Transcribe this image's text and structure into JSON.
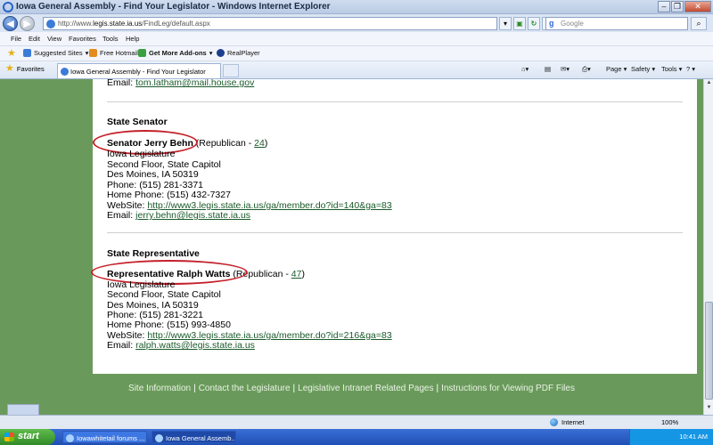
{
  "window": {
    "title": "Iowa General Assembly - Find Your Legislator - Windows Internet Explorer"
  },
  "address": {
    "prefix": "http://www.",
    "host": "legis.state.ia.us",
    "path": "/FindLeg/default.aspx"
  },
  "search": {
    "placeholder": "Google"
  },
  "menu": [
    "File",
    "Edit",
    "View",
    "Favorites",
    "Tools",
    "Help"
  ],
  "links": {
    "suggested": "Suggested Sites",
    "hotmail": "Free Hotmail",
    "addons": "Get More Add-ons",
    "realplayer": "RealPlayer"
  },
  "tabs": {
    "favorites": "Favorites",
    "active_tab": "Iowa General Assembly - Find Your Legislator"
  },
  "commands": {
    "page": "Page",
    "safety": "Safety",
    "tools": "Tools",
    "help": "?"
  },
  "content": {
    "prev_email_label": "Email:",
    "prev_email": "tom.latham@mail.house.gov",
    "senator": {
      "section": "State Senator",
      "name": "Senator Jerry Behn",
      "party_prefix": "(Republican - ",
      "district": "24",
      "party_suffix": ")",
      "org": "Iowa Legislature",
      "address1": "Second Floor, State Capitol",
      "address2": "Des Moines, IA   50319",
      "phone": "Phone: (515) 281-3371",
      "home_phone": "Home Phone: (515) 432-7327",
      "website_label": "WebSite:",
      "website": "http://www3.legis.state.ia.us/ga/member.do?id=140&ga=83",
      "email_label": "Email:",
      "email": "jerry.behn@legis.state.ia.us"
    },
    "representative": {
      "section": "State Representative",
      "name": "Representative Ralph Watts",
      "party_prefix": "(Republican - ",
      "district": "47",
      "party_suffix": ")",
      "org": "Iowa Legislature",
      "address1": "Second Floor, State Capitol",
      "address2": "Des Moines, IA   50319",
      "phone": "Phone: (515) 281-3221",
      "home_phone": "Home Phone: (515) 993-4850",
      "website_label": "WebSite:",
      "website": "http://www3.legis.state.ia.us/ga/member.do?id=216&ga=83",
      "email_label": "Email:",
      "email": "ralph.watts@legis.state.ia.us"
    }
  },
  "footer": {
    "site_info": "Site Information",
    "contact": "Contact the Legislature",
    "intranet": "Legislative Intranet Related Pages",
    "pdf": "Instructions for Viewing PDF Files",
    "sep": "|"
  },
  "status": {
    "zone": "Internet",
    "zoom": "100%"
  },
  "taskbar": {
    "start": "start",
    "task1": "Iowawhitetail forums ...",
    "task2": "Iowa General Assemb...",
    "clock": "10:41 AM"
  },
  "colors": {
    "page_bg": "#6a9a5b",
    "link": "#1a5a2a",
    "highlight_oval": "#c4202a"
  }
}
